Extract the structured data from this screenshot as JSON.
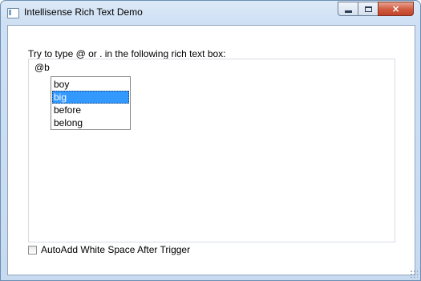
{
  "window": {
    "title": "Intellisense Rich Text Demo",
    "icon": "app-window-icon",
    "controls": {
      "minimize": "minimize-icon",
      "maximize": "maximize-icon",
      "close": "×"
    }
  },
  "main": {
    "prompt": "Try to type @ or . in the following rich text box:",
    "rich_text_value": "@b",
    "suggestions": {
      "items": [
        "boy",
        "big",
        "before",
        "belong"
      ],
      "selected": "big"
    },
    "checkbox": {
      "label": "AutoAdd White Space After Trigger",
      "checked": false
    }
  },
  "colors": {
    "selection": "#3399ff",
    "close_button": "#cf5a3f",
    "frame": "#c8daef"
  }
}
